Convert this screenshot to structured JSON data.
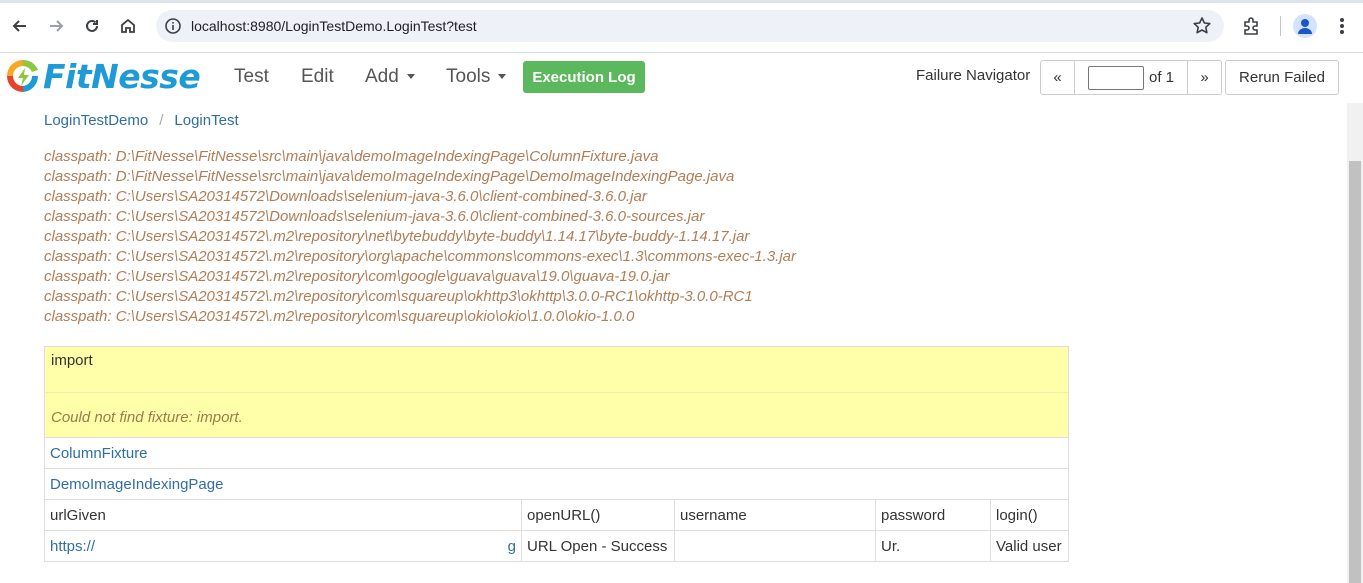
{
  "browser": {
    "url": "localhost:8980/LoginTestDemo.LoginTest?test",
    "icons": [
      "back-icon",
      "forward-icon",
      "reload-icon",
      "home-icon",
      "site-info-icon",
      "bookmark-star-icon",
      "extensions-icon",
      "profile-icon",
      "menu-kebab-icon"
    ]
  },
  "header": {
    "logo_text": "FitNesse",
    "menu": {
      "test": "Test",
      "edit": "Edit",
      "add": "Add",
      "tools": "Tools"
    },
    "execution_log": "Execution Log",
    "failure_navigator_label": "Failure Navigator",
    "pager": {
      "prev": "«",
      "page_value": "",
      "of_text": "of 1",
      "next": "»"
    },
    "rerun_failed": "Rerun Failed",
    "colors": {
      "logo_blue": "#1e9bd7",
      "logo_green": "#8dc63f",
      "logo_red": "#e8412c",
      "execlog_green": "#5cb85c"
    }
  },
  "breadcrumb": {
    "root": "LoginTestDemo",
    "separator": "/",
    "current": "LoginTest"
  },
  "classpaths": [
    "classpath: D:\\FitNesse\\FitNesse\\src\\main\\java\\demoImageIndexingPage\\ColumnFixture.java",
    "classpath: D:\\FitNesse\\FitNesse\\src\\main\\java\\demoImageIndexingPage\\DemoImageIndexingPage.java",
    "classpath: C:\\Users\\SA20314572\\Downloads\\selenium-java-3.6.0\\client-combined-3.6.0.jar",
    "classpath: C:\\Users\\SA20314572\\Downloads\\selenium-java-3.6.0\\client-combined-3.6.0-sources.jar",
    "classpath: C:\\Users\\SA20314572\\.m2\\repository\\net\\bytebuddy\\byte-buddy\\1.14.17\\byte-buddy-1.14.17.jar",
    "classpath: C:\\Users\\SA20314572\\.m2\\repository\\org\\apache\\commons\\commons-exec\\1.3\\commons-exec-1.3.jar",
    "classpath: C:\\Users\\SA20314572\\.m2\\repository\\com\\google\\guava\\guava\\19.0\\guava-19.0.jar",
    "classpath: C:\\Users\\SA20314572\\.m2\\repository\\com\\squareup\\okhttp3\\okhttp\\3.0.0-RC1\\okhttp-3.0.0-RC1",
    "classpath: C:\\Users\\SA20314572\\.m2\\repository\\com\\squareup\\okio\\okio\\1.0.0\\okio-1.0.0"
  ],
  "table": {
    "import_label": "import",
    "import_error": "Could not find fixture: import.",
    "fixture_row1": "ColumnFixture",
    "fixture_row2": "DemoImageIndexingPage",
    "headers": [
      "urlGiven",
      "openURL()",
      "username",
      "password",
      "login()"
    ],
    "row": {
      "url_prefix": "https://",
      "url_tail": "g",
      "open_result": "URL Open - Success",
      "username": "",
      "password_prefix": "Ur.",
      "login_result": "Valid user"
    },
    "colors": {
      "error_bg": "#ffffaa",
      "link": "#2f6f9f",
      "classpath_text": "#b07d55"
    }
  }
}
